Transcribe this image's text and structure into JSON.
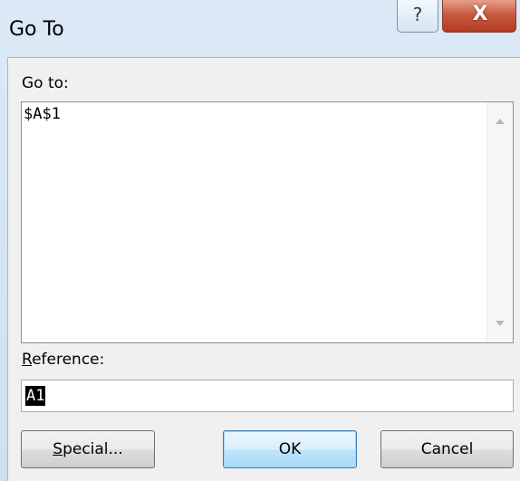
{
  "window": {
    "title": "Go To",
    "help_glyph": "?",
    "close_glyph": "X"
  },
  "goto": {
    "label": "Go to:",
    "items": [
      "$A$1"
    ]
  },
  "reference": {
    "label_underlined": "R",
    "label_rest": "eference:",
    "value": "A1"
  },
  "buttons": {
    "special_underlined": "S",
    "special_rest": "pecial...",
    "ok": "OK",
    "cancel": "Cancel"
  },
  "icons": {
    "help": "help-icon",
    "close": "close-icon",
    "scroll_up": "scroll-up-arrow-icon",
    "scroll_down": "scroll-down-arrow-icon"
  }
}
